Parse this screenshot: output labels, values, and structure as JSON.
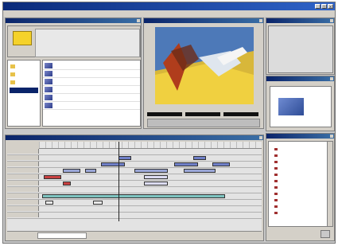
{
  "window": {
    "title": ""
  },
  "menu": [],
  "project": {
    "title": "",
    "items": []
  },
  "monitor": {
    "title": ""
  },
  "timeline": {
    "title": "",
    "tracks": []
  },
  "navigator": {
    "title": ""
  },
  "history": {
    "title": "",
    "items": []
  },
  "colors": {
    "titlebar": "#0a246a",
    "panel": "#d4d0c8",
    "track_clip_blue": "#6f7fc8",
    "track_clip_teal": "#7ec3c0",
    "track_clip_red": "#c84040"
  },
  "icons": [
    "folder-icon",
    "close-icon",
    "minimize-icon",
    "maximize-icon",
    "history-step-icon"
  ]
}
